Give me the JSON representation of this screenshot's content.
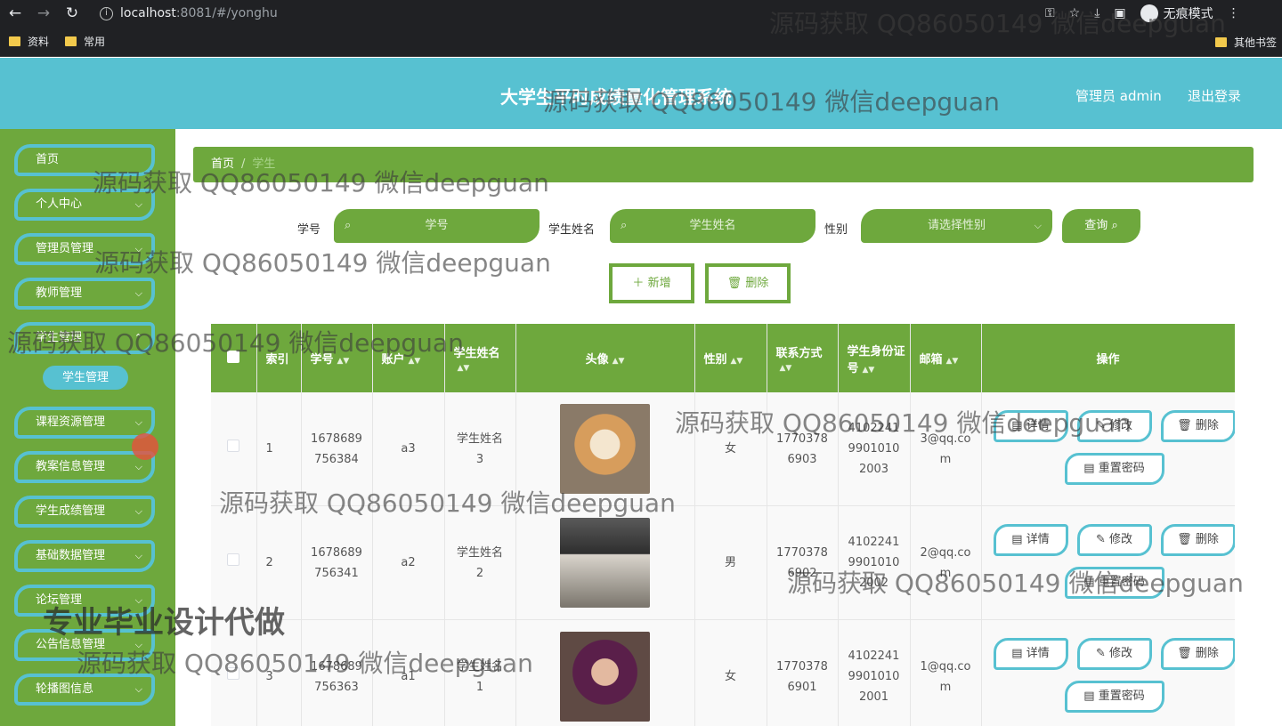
{
  "browser": {
    "url_host": "localhost",
    "url_rest": ":8081/#/yonghu",
    "incognito_label": "无痕模式",
    "bookmarks": [
      "资料",
      "常用"
    ],
    "other_bookmarks": "其他书签"
  },
  "header": {
    "title": "大学生平时成绩量化管理系统",
    "admin_label": "管理员 admin",
    "logout": "退出登录"
  },
  "sidebar": {
    "items": [
      "首页",
      "个人中心",
      "管理员管理",
      "教师管理",
      "学生管理",
      "课程资源管理",
      "教案信息管理",
      "学生成绩管理",
      "基础数据管理",
      "论坛管理",
      "公告信息管理",
      "轮播图信息"
    ],
    "active_sub": "学生管理"
  },
  "breadcrumb": {
    "home": "首页",
    "sep": "/",
    "current": "学生"
  },
  "search": {
    "id_label": "学号",
    "id_placeholder": "学号",
    "name_label": "学生姓名",
    "name_placeholder": "学生姓名",
    "gender_label": "性别",
    "gender_placeholder": "请选择性别",
    "query_button": "查询"
  },
  "actions": {
    "add": "新增",
    "delete": "删除"
  },
  "table": {
    "headers": [
      "索引",
      "学号",
      "账户",
      "学生姓名",
      "头像",
      "性别",
      "联系方式",
      "学生身份证号",
      "邮箱",
      "操作"
    ],
    "rows": [
      {
        "index": "1",
        "student_id": "1678689756384",
        "account": "a3",
        "name": "学生姓名3",
        "gender": "女",
        "phone": "17703786903",
        "id_card": "410224199010102003",
        "email": "3@qq.com",
        "avatar": "shiba-dog-photo"
      },
      {
        "index": "2",
        "student_id": "1678689756341",
        "account": "a2",
        "name": "学生姓名2",
        "gender": "男",
        "phone": "17703786902",
        "id_card": "410224199010102002",
        "email": "2@qq.com",
        "avatar": "man-portrait-photo"
      },
      {
        "index": "3",
        "student_id": "1678689756363",
        "account": "a1",
        "name": "学生姓名1",
        "gender": "女",
        "phone": "17703786901",
        "id_card": "410224199010102001",
        "email": "1@qq.com",
        "avatar": "purple-hair-man-photo"
      }
    ],
    "op_detail": "详情",
    "op_edit": "修改",
    "op_delete": "删除",
    "op_reset": "重置密码"
  },
  "watermarks": {
    "text": "源码获取 QQ86050149 微信deepguan",
    "promo": "专业毕业设计代做"
  },
  "colors": {
    "header": "#57c1d1",
    "sidebar": "#6ea83d",
    "accent": "#57c1d1"
  }
}
